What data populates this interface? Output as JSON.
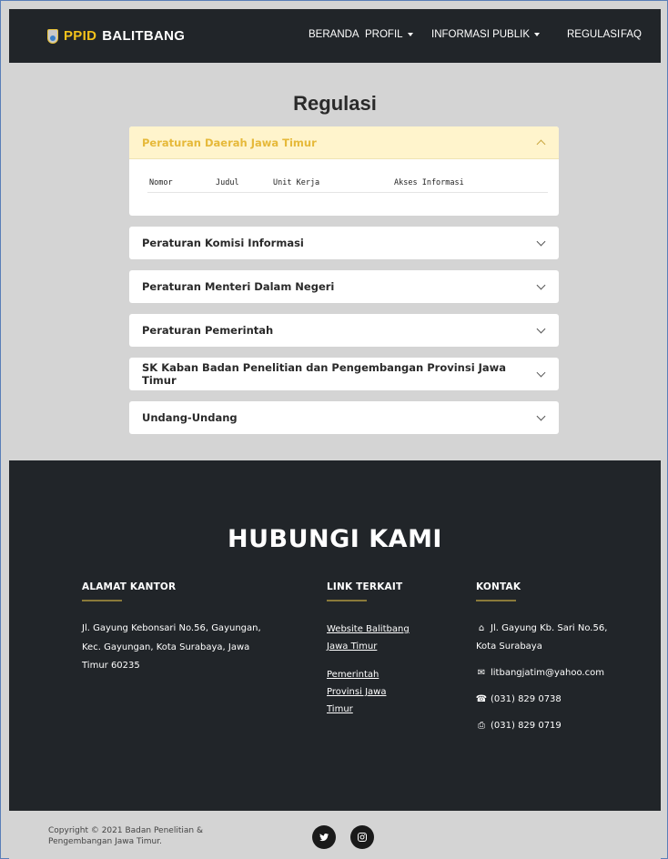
{
  "nav": {
    "brand_accent": "PPID",
    "brand_rest": "BALITBANG",
    "links": [
      "BERANDA",
      "PROFIL",
      "INFORMASI PUBLIK",
      "REGULASI",
      "FAQ"
    ]
  },
  "main": {
    "title": "Regulasi",
    "open_section": {
      "title": "Peraturan Daerah Jawa Timur",
      "columns": [
        "Nomor",
        "Judul",
        "Unit Kerja",
        "Akses Informasi"
      ]
    },
    "sections": [
      "Peraturan Komisi Informasi",
      "Peraturan Menteri Dalam Negeri",
      "Peraturan Pemerintah",
      "SK Kaban Badan Penelitian dan Pengembangan Provinsi Jawa Timur",
      "Undang-Undang"
    ]
  },
  "contact": {
    "title": "HUBUNGI KAMI",
    "address_head": "ALAMAT KANTOR",
    "address_lines": [
      "Jl. Gayung Kebonsari No.56, Gayungan,",
      "Kec. Gayungan, Kota Surabaya, Jawa",
      "Timur 60235"
    ],
    "links_head": "LINK TERKAIT",
    "links": [
      [
        "Website Balitbang",
        "Jawa Timur"
      ],
      [
        "Pemerintah",
        "Provinsi Jawa",
        "Timur"
      ]
    ],
    "kontak_head": "KONTAK",
    "kontak_address": [
      "Jl. Gayung Kb. Sari No.56,",
      "Kota Surabaya"
    ],
    "email": "litbangjatim@yahoo.com",
    "phone": "(031) 829 0738",
    "fax": "(031) 829 0719"
  },
  "footer": {
    "copyright_lines": [
      "Copyright © 2021 Badan Penelitian &",
      "Pengembangan Jawa Timur."
    ],
    "social": [
      "twitter-icon",
      "instagram-icon"
    ]
  },
  "colors": {
    "nav_bg": "#212529",
    "accent": "#f4c21b",
    "open_header_bg": "#fff4cc",
    "open_header_text": "#e6b93a",
    "page_bg": "#d4d4d4"
  }
}
